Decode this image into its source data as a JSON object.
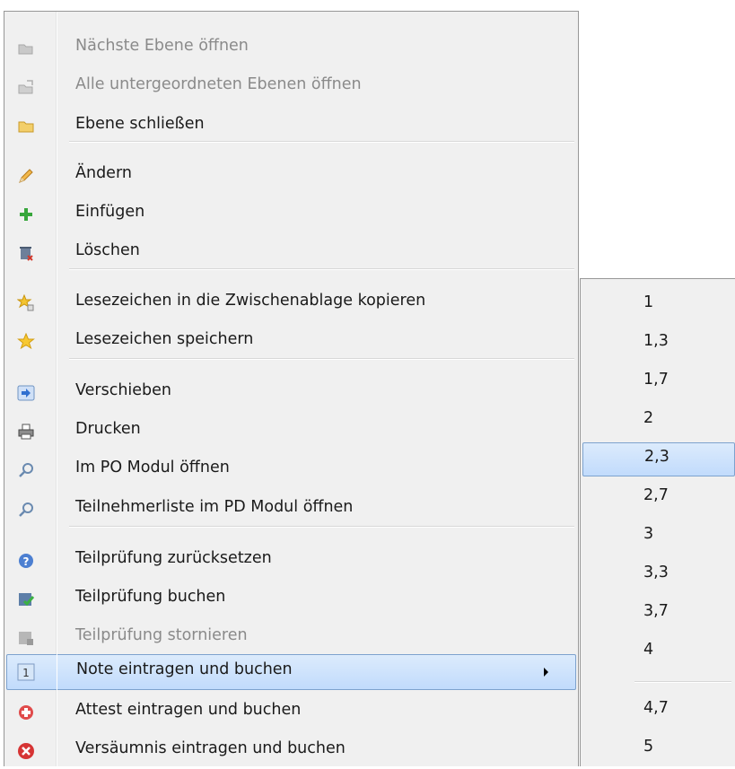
{
  "menu": {
    "items": [
      {
        "label": "Nächste Ebene öffnen",
        "icon": "folder-open-icon",
        "disabled": true
      },
      {
        "label": "Alle untergeordneten Ebenen öffnen",
        "icon": "folder-export-icon",
        "disabled": true
      },
      {
        "label": "Ebene schließen",
        "icon": "folder-icon",
        "disabled": false
      },
      {
        "label": "Ändern",
        "icon": "pencil-icon",
        "disabled": false
      },
      {
        "label": "Einfügen",
        "icon": "plus-icon",
        "disabled": false
      },
      {
        "label": "Löschen",
        "icon": "trash-icon",
        "disabled": false
      },
      {
        "label": "Lesezeichen in die Zwischenablage kopieren",
        "icon": "star-copy-icon",
        "disabled": false
      },
      {
        "label": "Lesezeichen speichern",
        "icon": "star-icon",
        "disabled": false
      },
      {
        "label": "Verschieben",
        "icon": "arrow-right-icon",
        "disabled": false
      },
      {
        "label": "Drucken",
        "icon": "printer-icon",
        "disabled": false
      },
      {
        "label": "Im PO Modul öffnen",
        "icon": "magnifier-icon",
        "disabled": false
      },
      {
        "label": "Teilnehmerliste im PD Modul öffnen",
        "icon": "magnifier-icon",
        "disabled": false
      },
      {
        "label": "Teilprüfung zurücksetzen",
        "icon": "help-icon",
        "disabled": false
      },
      {
        "label": "Teilprüfung buchen",
        "icon": "check-book-icon",
        "disabled": false
      },
      {
        "label": "Teilprüfung stornieren",
        "icon": "cancel-book-icon",
        "disabled": true
      },
      {
        "label": "Note eintragen und buchen",
        "icon": "number-one-icon",
        "disabled": false,
        "highlighted": true,
        "has_submenu": true
      },
      {
        "label": "Attest eintragen und buchen",
        "icon": "medical-cross-icon",
        "disabled": false
      },
      {
        "label": "Versäumnis eintragen und buchen",
        "icon": "error-circle-icon",
        "disabled": false
      }
    ]
  },
  "submenu": {
    "items": [
      "1",
      "1,3",
      "1,7",
      "2",
      "2,3",
      "2,7",
      "3",
      "3,3",
      "3,7",
      "4",
      "4,7",
      "5"
    ],
    "highlighted": "2,3"
  },
  "colors": {
    "highlight_top": "#dcebfc",
    "highlight_bottom": "#c1dbfc",
    "highlight_border": "#7da2ce",
    "menu_bg": "#f0f0f0",
    "disabled_text": "#8a8a8a"
  }
}
